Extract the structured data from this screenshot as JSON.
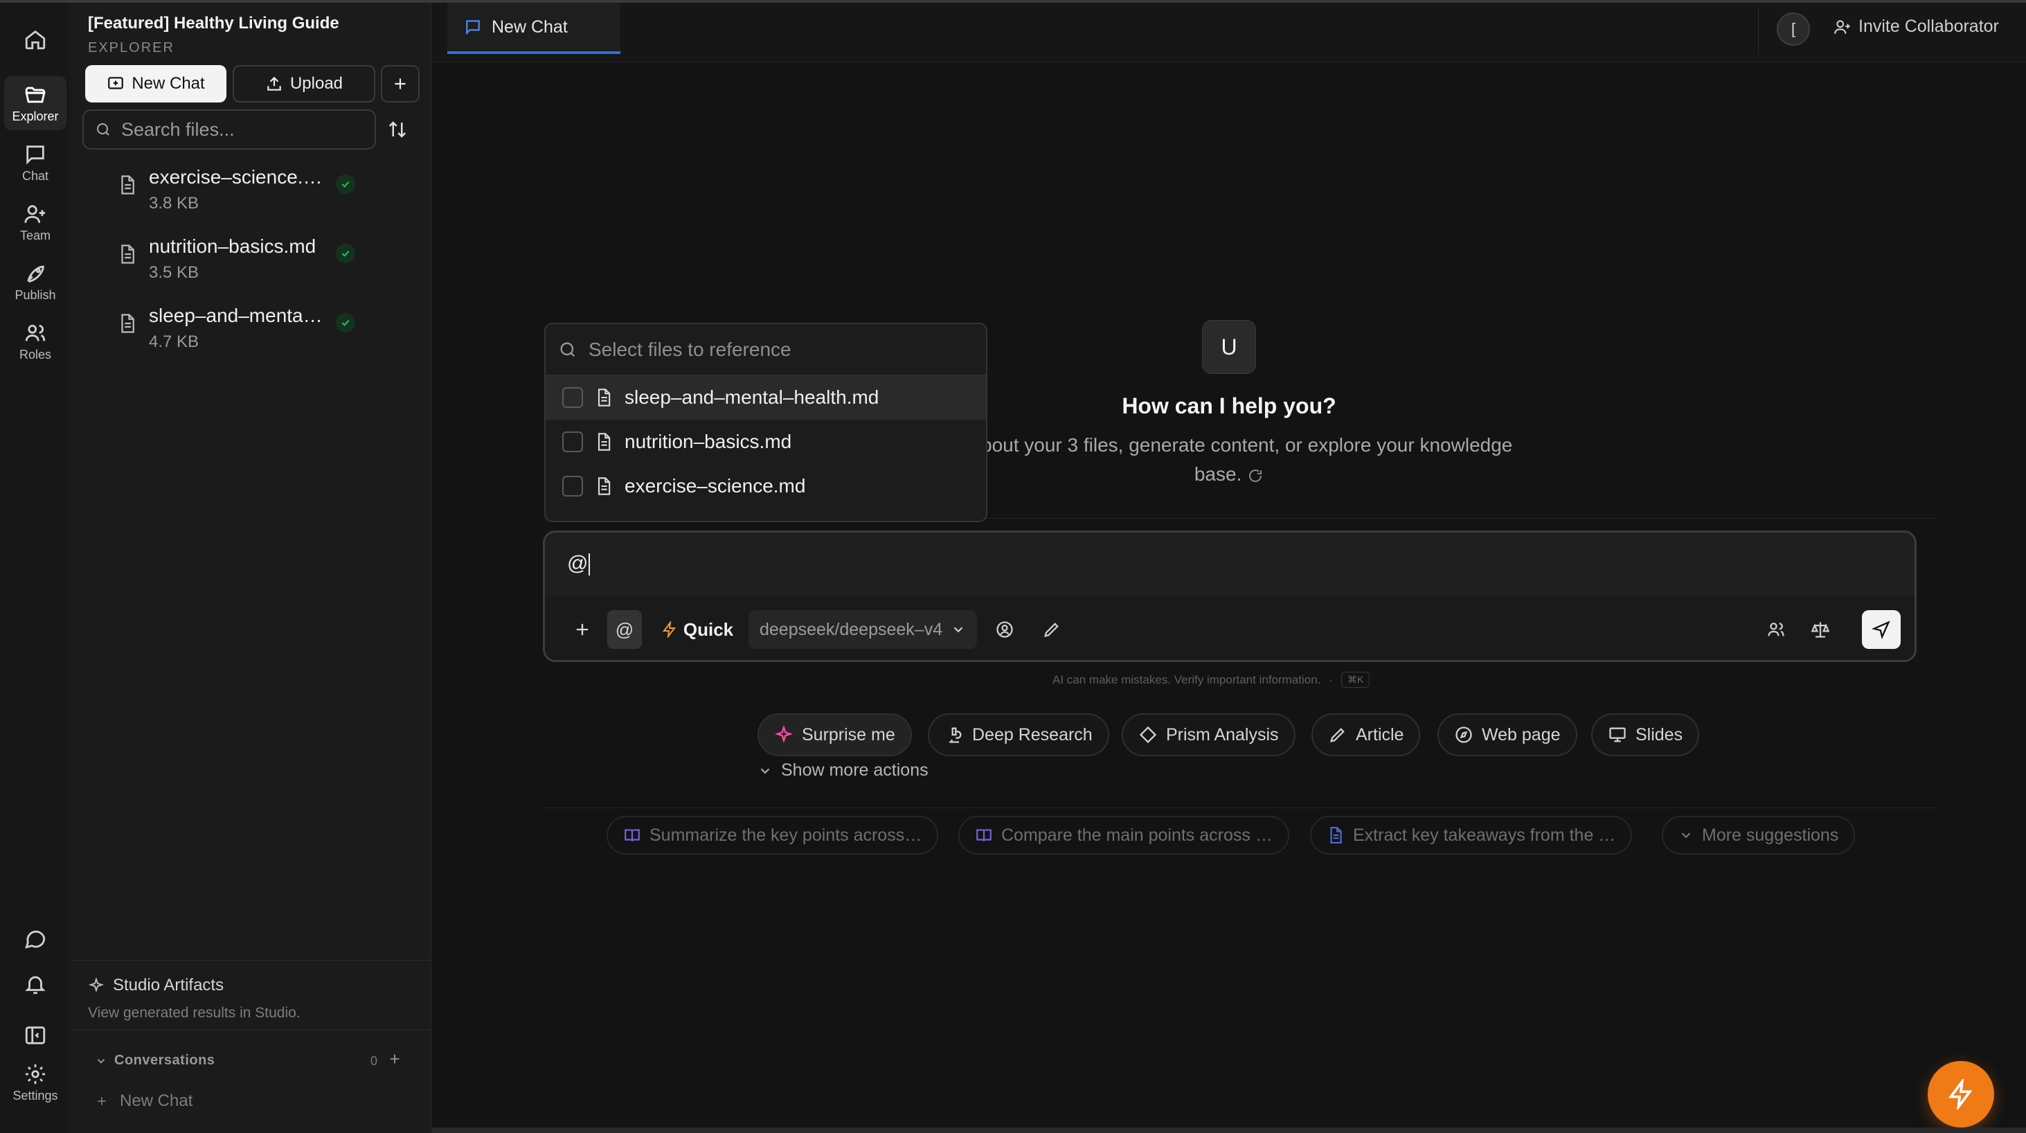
{
  "rail": {
    "items": [
      {
        "icon": "home-icon",
        "label": ""
      },
      {
        "icon": "folder-open-icon",
        "label": "Explorer",
        "active": true
      },
      {
        "icon": "chat-icon",
        "label": "Chat"
      },
      {
        "icon": "user-plus-icon",
        "label": "Team"
      },
      {
        "icon": "rocket-icon",
        "label": "Publish"
      },
      {
        "icon": "users-icon",
        "label": "Roles"
      }
    ],
    "bottom": [
      {
        "icon": "message-circle-icon",
        "label": ""
      },
      {
        "icon": "bell-icon",
        "label": ""
      },
      {
        "icon": "panel-left-icon",
        "label": ""
      },
      {
        "icon": "gear-icon",
        "label": "Settings"
      }
    ]
  },
  "explorer": {
    "project_title": "[Featured] Healthy Living Guide",
    "section_label": "EXPLORER",
    "new_chat_label": "New Chat",
    "upload_label": "Upload",
    "search_placeholder": "Search files...",
    "files": [
      {
        "name": "exercise–science.…",
        "size": "3.8 KB",
        "status": "synced"
      },
      {
        "name": "nutrition–basics.md",
        "size": "3.5 KB",
        "status": "synced"
      },
      {
        "name": "sleep–and–menta…",
        "size": "4.7 KB",
        "status": "synced"
      }
    ],
    "studio_title": "Studio Artifacts",
    "studio_sub": "View generated results in Studio.",
    "conversations_label": "Conversations",
    "conversations_count": "0",
    "conversation_new": "New Chat"
  },
  "tabbar": {
    "tab_label": "New Chat",
    "avatar_initial": "[",
    "invite_label": "Invite Collaborator"
  },
  "hero": {
    "avatar_initial": "U",
    "title": "How can I help you?",
    "subtitle": "sk about your 3 files, generate content, or explore your knowledge base."
  },
  "file_picker": {
    "placeholder": "Select files to reference",
    "items": [
      {
        "name": "sleep–and–mental–health.md",
        "checked": false
      },
      {
        "name": "nutrition–basics.md",
        "checked": false
      },
      {
        "name": "exercise–science.md",
        "checked": false
      }
    ]
  },
  "composer": {
    "input_value": "@",
    "at_label": "@",
    "mode_label": "Quick",
    "model_label": "deepseek/deepseek–v4",
    "disclaimer": "AI can make mistakes. Verify important information.",
    "shortcut": "⌘K"
  },
  "actions": [
    {
      "label": "Surprise me",
      "icon": "sparkles-icon"
    },
    {
      "label": "Deep Research",
      "icon": "microscope-icon"
    },
    {
      "label": "Prism Analysis",
      "icon": "diamond-icon"
    },
    {
      "label": "Article",
      "icon": "pen-icon"
    },
    {
      "label": "Web page",
      "icon": "compass-icon"
    },
    {
      "label": "Slides",
      "icon": "presentation-icon"
    }
  ],
  "show_more_label": "Show more actions",
  "suggestions": [
    {
      "label": "Summarize the key points across…",
      "icon": "book-icon"
    },
    {
      "label": "Compare the main points across …",
      "icon": "book-icon"
    },
    {
      "label": "Extract key takeaways from the …",
      "icon": "document-icon"
    },
    {
      "label": "More suggestions",
      "icon": "chevron-down-icon"
    }
  ],
  "colors": {
    "accent_blue": "#2f6fe0",
    "fab_orange": "#f07a16",
    "surprise_pink": "#ff4fa8",
    "success_green": "#22c55e"
  }
}
